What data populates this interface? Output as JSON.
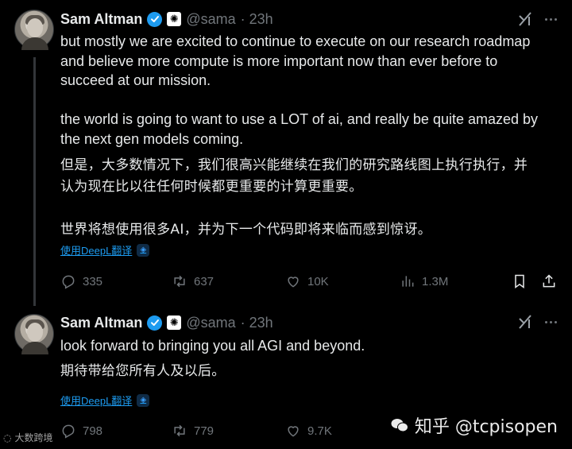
{
  "tweets": [
    {
      "author": {
        "name": "Sam Altman",
        "handle": "@sama",
        "time": "· 23h"
      },
      "text_en": "but mostly we are excited to continue to execute on our research roadmap\nand believe more compute is more important now than ever before to\nsucceed at our mission.\n\nthe world is going to want to use a LOT of ai, and really be quite amazed by\nthe next gen models coming.",
      "text_cn": "但是，大多数情况下，我们很高兴能继续在我们的研究路线图上执行执行，并\n认为现在比以往任何时候都更重要的计算更重要。\n\n世界将想使用很多AI，并为下一个代码即将来临而感到惊讶。",
      "translate_label": "使用DeepL翻译",
      "stats": {
        "replies": "335",
        "reposts": "637",
        "likes": "10K",
        "views": "1.3M"
      }
    },
    {
      "author": {
        "name": "Sam Altman",
        "handle": "@sama",
        "time": "· 23h"
      },
      "text_en": "look forward to bringing you all AGI and beyond.",
      "text_cn": "期待带给您所有人及以后。",
      "translate_label": "使用DeepL翻译",
      "stats": {
        "replies": "798",
        "reposts": "779",
        "likes": "9.7K"
      }
    }
  ],
  "watermark": {
    "zhihu": "知乎 @tcpisopen",
    "left": "大数跨境"
  },
  "colors": {
    "background": "#000000",
    "text": "#e7e9ea",
    "muted": "#71767b",
    "link": "#1d9bf0"
  },
  "icons": [
    "verified-icon",
    "openai-badge-icon",
    "grok-icon",
    "more-icon",
    "reply-icon",
    "repost-icon",
    "like-icon",
    "views-icon",
    "bookmark-icon",
    "share-icon",
    "deepl-icon"
  ]
}
